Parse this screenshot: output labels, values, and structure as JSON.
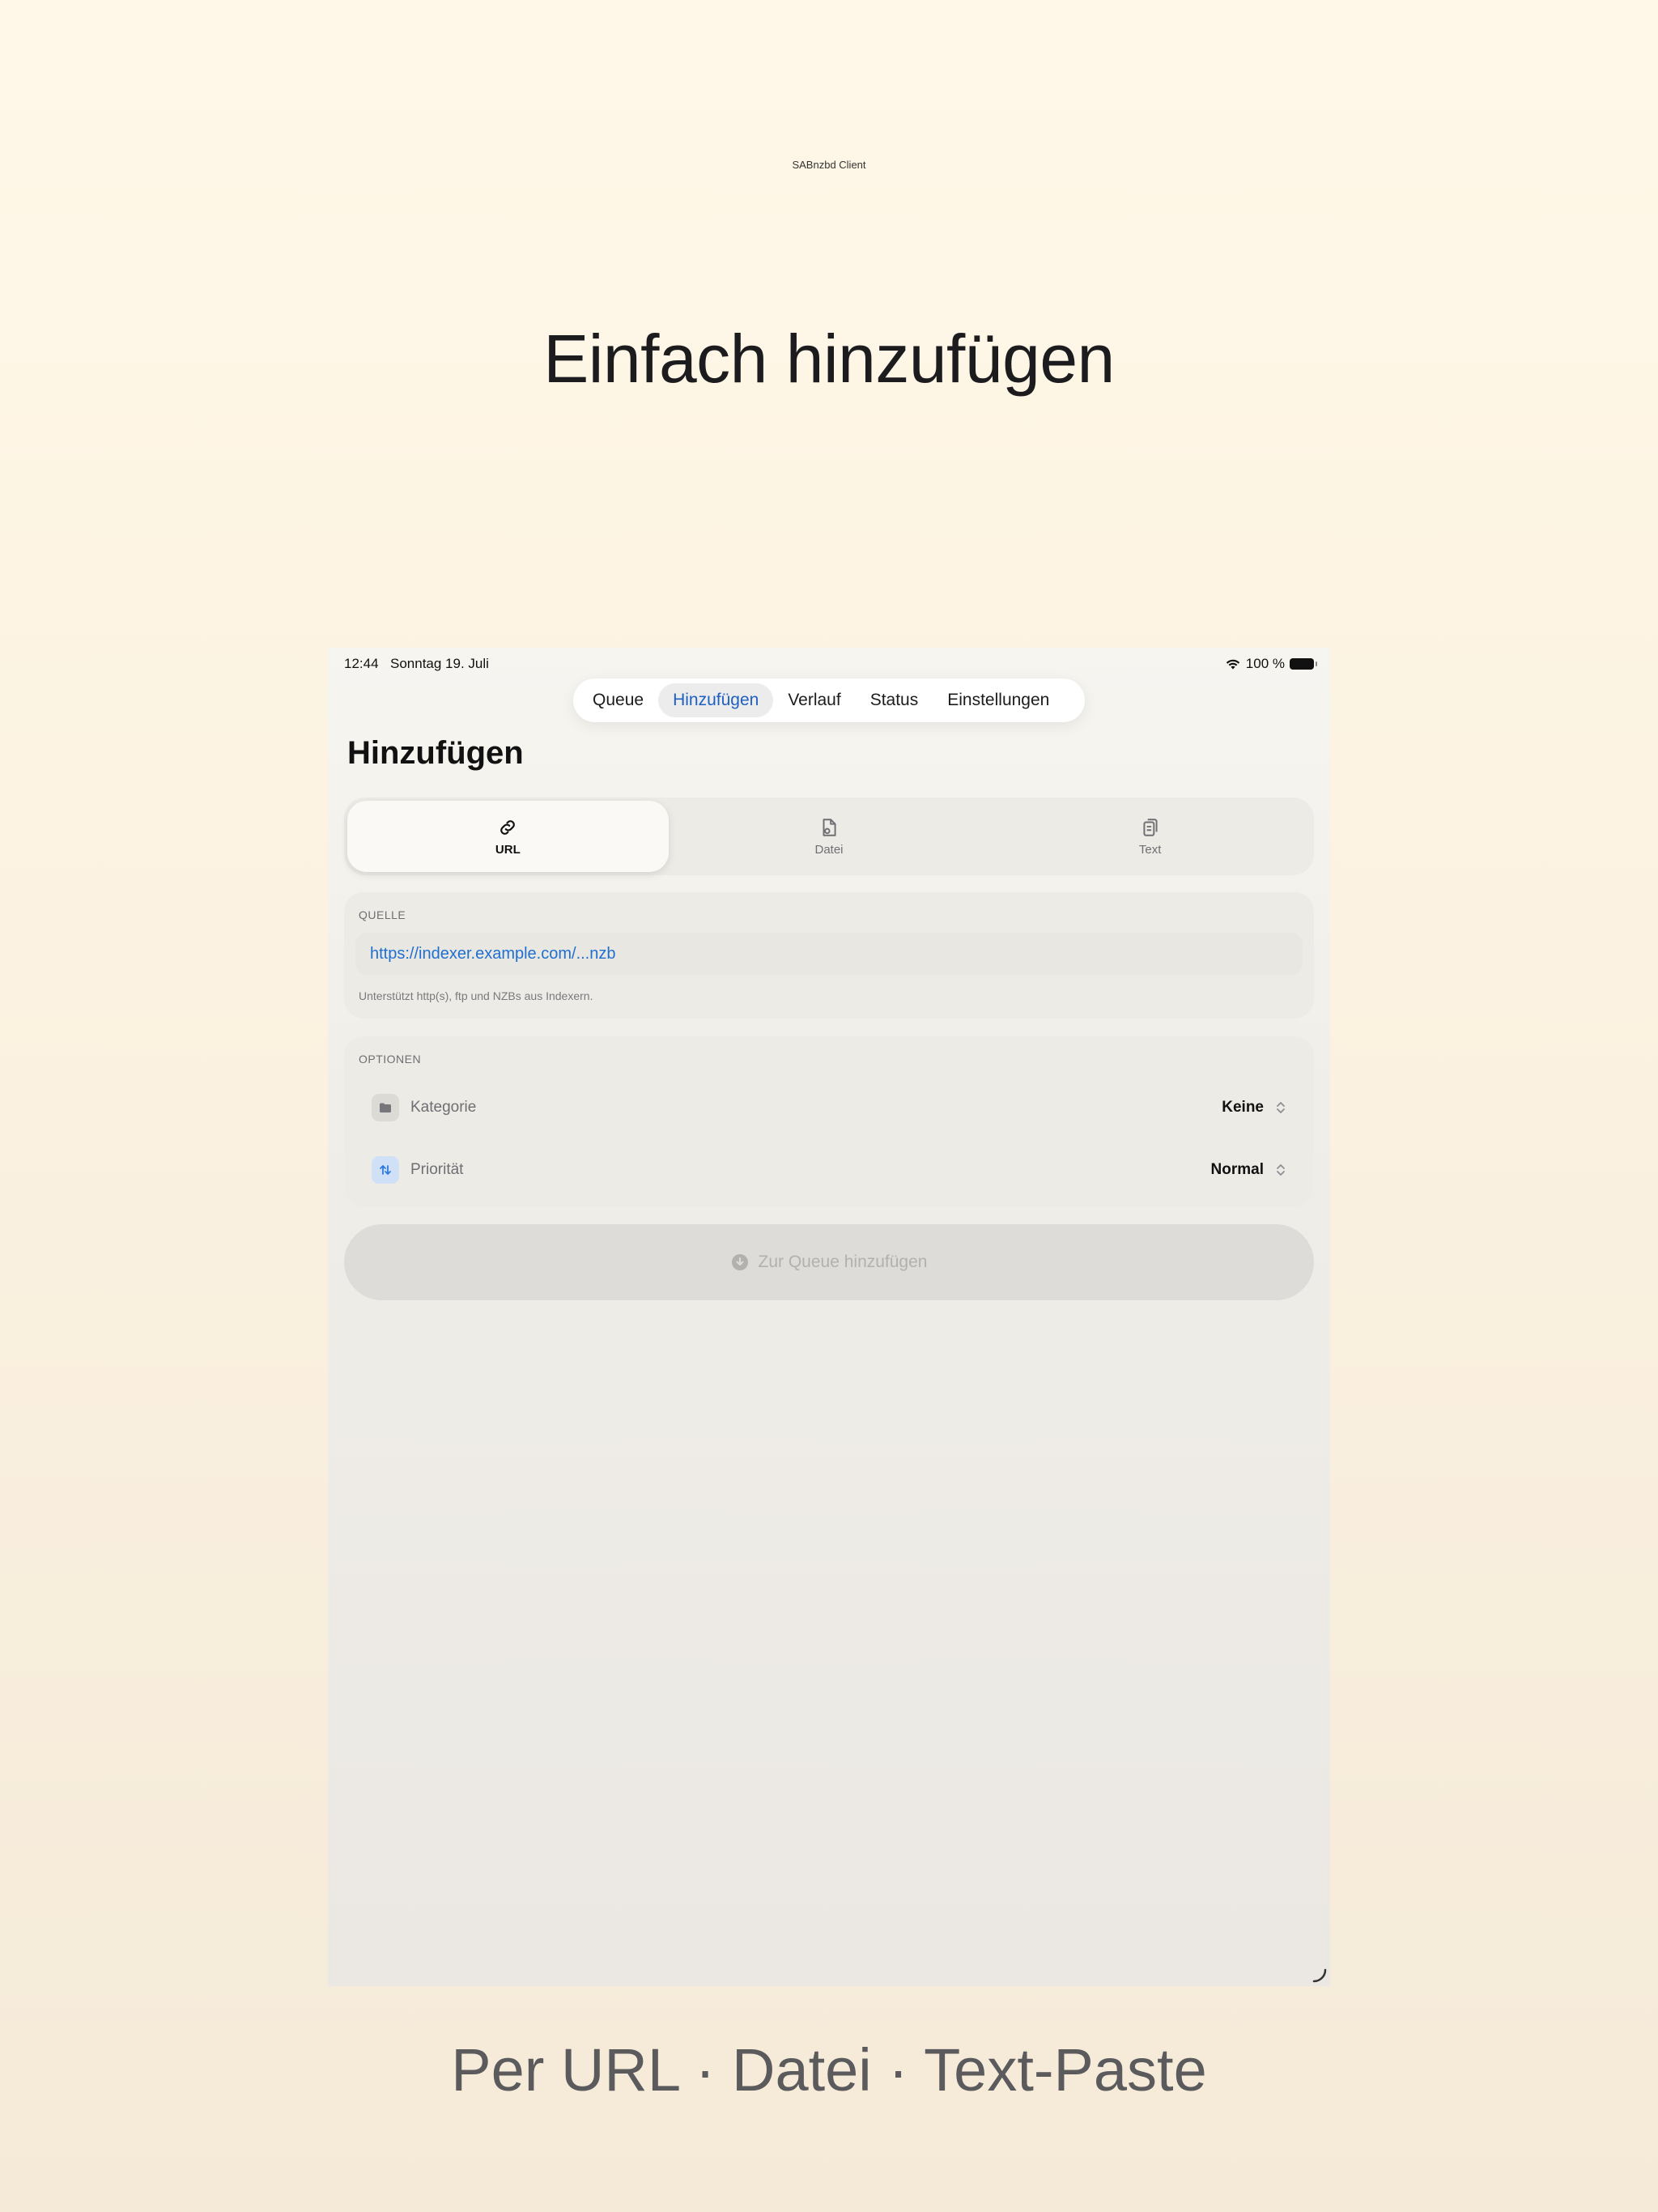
{
  "marketing": {
    "brand_name": "SABnzbd Client",
    "brand_accent": "",
    "headline": "Einfach hinzufügen",
    "subline": "Per URL · Datei · Text-Paste"
  },
  "status_bar": {
    "time": "12:44",
    "date": "Sonntag 19. Juli",
    "battery": "100 %"
  },
  "tabs": [
    {
      "label": "Queue",
      "active": false
    },
    {
      "label": "Hinzufügen",
      "active": true
    },
    {
      "label": "Verlauf",
      "active": false
    },
    {
      "label": "Status",
      "active": false
    },
    {
      "label": "Einstellungen",
      "active": false
    }
  ],
  "page_title": "Hinzufügen",
  "source_modes": [
    {
      "label": "URL",
      "icon": "link-icon",
      "active": true
    },
    {
      "label": "Datei",
      "icon": "document-icon",
      "active": false
    },
    {
      "label": "Text",
      "icon": "clipboard-icon",
      "active": false
    }
  ],
  "source": {
    "section_label": "QUELLE",
    "url_placeholder": "https://indexer.example.com/...nzb",
    "hint": "Unterstützt http(s), ftp und NZBs aus Indexern."
  },
  "options": {
    "section_label": "OPTIONEN",
    "category_label": "Kategorie",
    "category_value": "Keine",
    "priority_label": "Priorität",
    "priority_value": "Normal"
  },
  "add_button_label": "Zur Queue hinzufügen",
  "colors": {
    "accent": "#1f6fd0",
    "active_tab_text": "#1f5fc2",
    "disabled_button": "#dedcd8"
  }
}
